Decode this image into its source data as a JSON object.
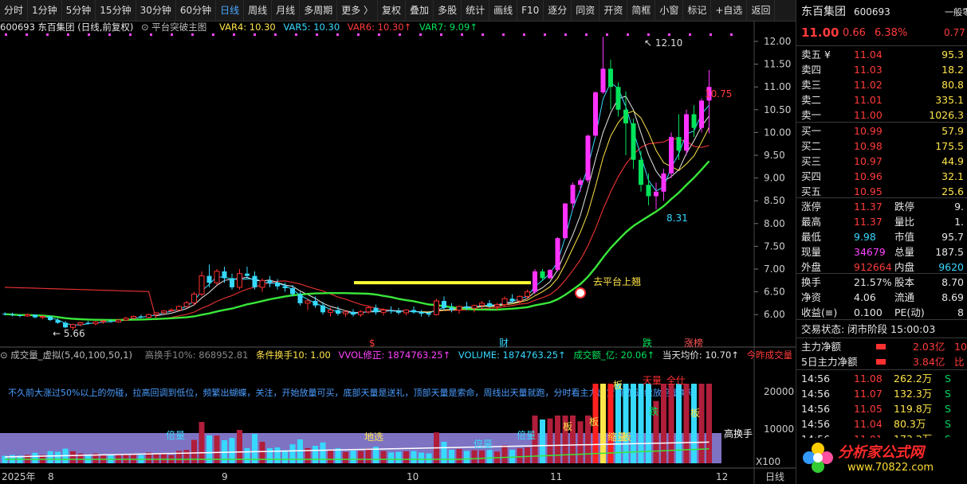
{
  "toolbar": {
    "items": [
      "分时",
      "1分钟",
      "5分钟",
      "15分钟",
      "30分钟",
      "60分钟",
      "日线",
      "周线",
      "月线",
      "多周期",
      "更多 〉",
      "复权",
      "叠加",
      "多股",
      "统计",
      "画线",
      "F10",
      "逐分",
      "同资",
      "开资",
      "简框",
      "小窗",
      "标记",
      "+自选",
      "返回"
    ],
    "active": "日线"
  },
  "infobar": {
    "stock": "600693 东百集团 (日线,前复权)",
    "indicator": "平台突破主图",
    "var4": "VAR4: 10.30",
    "var5": "VAR5: 10.30",
    "var6": "VAR6: 10.30↑",
    "var7": "VAR7: 9.09↑"
  },
  "price_axis": [
    "12.00",
    "11.50",
    "11.00",
    "10.50",
    "10.00",
    "9.50",
    "9.00",
    "8.50",
    "8.00",
    "7.50",
    "7.00",
    "6.50",
    "6.00"
  ],
  "chart_annotations": {
    "high_label": "12.10",
    "low_label": "5.66",
    "dip_label": "8.31",
    "last_label": "10.75",
    "breakout_text": "去平台上翘",
    "markers": [
      "$",
      "财",
      "跌",
      "涨榜"
    ]
  },
  "volinfo": {
    "title": "成交量_虚拟(5,40,100,50,1)",
    "hsl": "高换手10%: 868952.81",
    "cond": "条件换手10: 1.00",
    "vvol": "VVOL修正: 1874763.25↑",
    "volume": "VOLUME: 1874763.25↑",
    "amount": "成交额_亿: 20.06↑",
    "avg": "当天均价: 10.70↑",
    "today": "今昨成交量"
  },
  "vol_axis": [
    "20000",
    "10000",
    "X100"
  ],
  "vol_note": "不久前大涨过50%以上的勿碰，拉高回调到低位，频繁出蝴蝶，关注，开始放量可买，底部天量是送礼，顶部天量是索命，周线出天量就跑，分时看主力出货痕迹,连续放倍量4天",
  "vol_labels": [
    "倍量",
    "地选",
    "倍量",
    "倍量",
    "板",
    "板",
    "天量",
    "全仕",
    "板",
    "板",
    "缩量",
    "跌",
    "板",
    "高换手"
  ],
  "time_axis": [
    "2025年",
    "8",
    "9",
    "10",
    "11",
    "12"
  ],
  "time_axis_right": "日线",
  "panel": {
    "name": "东百集团",
    "code": "600693",
    "sector": "一般零",
    "price": "11.00",
    "change": "0.66",
    "pct": "6.38%",
    "extra": "0.77",
    "sells": [
      {
        "label": "卖五 ¥",
        "price": "11.04",
        "vol": "95.3"
      },
      {
        "label": "卖四",
        "price": "11.03",
        "vol": "18.2"
      },
      {
        "label": "卖三",
        "price": "11.02",
        "vol": "80.8"
      },
      {
        "label": "卖二",
        "price": "11.01",
        "vol": "335.1"
      },
      {
        "label": "卖一",
        "price": "11.00",
        "vol": "1026.3"
      }
    ],
    "buys": [
      {
        "label": "买一",
        "price": "10.99",
        "vol": "57.9"
      },
      {
        "label": "买二",
        "price": "10.98",
        "vol": "175.5"
      },
      {
        "label": "买三",
        "price": "10.97",
        "vol": "44.9"
      },
      {
        "label": "买四",
        "price": "10.96",
        "vol": "32.1"
      },
      {
        "label": "买五",
        "price": "10.95",
        "vol": "25.6"
      }
    ],
    "stats": [
      {
        "l1": "涨停",
        "v1": "11.37",
        "l2": "跌停",
        "v2": "9."
      },
      {
        "l1": "最高",
        "v1": "11.37",
        "l2": "量比",
        "v2": "1."
      },
      {
        "l1": "最低",
        "v1": "9.98",
        "l2": "市值",
        "v2": "95.7"
      },
      {
        "l1": "现量",
        "v1": "34679",
        "l2": "总量",
        "v2": "187.5"
      },
      {
        "l1": "外盘",
        "v1": "912664",
        "l2": "内盘",
        "v2": "9620"
      }
    ],
    "stats2": [
      {
        "l1": "换手",
        "v1": "21.57%",
        "l2": "股本",
        "v2": "8.70"
      },
      {
        "l1": "净资",
        "v1": "4.06",
        "l2": "流通",
        "v2": "8.69"
      },
      {
        "l1": "收益(≡)",
        "v1": "0.100",
        "l2": "PE(动)",
        "v2": "8"
      }
    ],
    "status": "交易状态: 闭市阶段 15:00:03",
    "flow": [
      {
        "label": "主力净额",
        "value": "2.03亿",
        "extra": "10"
      },
      {
        "label": "5日主力净额",
        "value": "3.84亿",
        "extra": "比"
      }
    ],
    "ticks": [
      {
        "time": "14:56",
        "price": "11.08",
        "vol": "262.2万",
        "side": "S"
      },
      {
        "time": "14:56",
        "price": "11.07",
        "vol": "132.3万",
        "side": "S"
      },
      {
        "time": "14:56",
        "price": "11.05",
        "vol": "119.8万",
        "side": "S"
      },
      {
        "time": "14:56",
        "price": "11.04",
        "vol": "80.3万",
        "side": "S"
      },
      {
        "time": "14:56",
        "price": "11.01",
        "vol": "173.2万",
        "side": "S"
      }
    ],
    "watermark": "分析家公式网",
    "watermark_url": "www.70822.com"
  },
  "candles": [
    [
      6.02,
      6.05,
      5.98,
      6.01
    ],
    [
      6.01,
      6.04,
      5.96,
      5.99
    ],
    [
      5.99,
      6.0,
      5.94,
      5.97
    ],
    [
      5.97,
      6.02,
      5.95,
      6.0
    ],
    [
      6.0,
      6.01,
      5.92,
      5.94
    ],
    [
      5.94,
      5.98,
      5.9,
      5.96
    ],
    [
      5.96,
      5.97,
      5.86,
      5.88
    ],
    [
      5.88,
      5.92,
      5.8,
      5.82
    ],
    [
      5.82,
      5.86,
      5.7,
      5.72
    ],
    [
      5.72,
      5.8,
      5.66,
      5.78
    ],
    [
      5.78,
      5.84,
      5.74,
      5.82
    ],
    [
      5.82,
      5.86,
      5.78,
      5.8
    ],
    [
      5.8,
      5.86,
      5.76,
      5.84
    ],
    [
      5.84,
      5.88,
      5.8,
      5.86
    ],
    [
      5.86,
      5.9,
      5.82,
      5.84
    ],
    [
      5.84,
      5.9,
      5.82,
      5.88
    ],
    [
      5.88,
      5.95,
      5.86,
      5.92
    ],
    [
      5.92,
      5.98,
      5.9,
      5.96
    ],
    [
      5.96,
      6.0,
      5.92,
      5.94
    ],
    [
      5.94,
      6.02,
      5.92,
      6.0
    ],
    [
      6.0,
      6.05,
      5.96,
      6.04
    ],
    [
      6.04,
      6.1,
      6.02,
      6.08
    ],
    [
      6.08,
      6.14,
      6.06,
      6.1
    ],
    [
      6.1,
      6.2,
      6.08,
      6.18
    ],
    [
      6.18,
      6.3,
      6.15,
      6.26
    ],
    [
      6.26,
      6.5,
      6.2,
      6.45
    ],
    [
      6.45,
      6.95,
      6.4,
      6.85
    ],
    [
      6.85,
      7.1,
      6.6,
      6.7
    ],
    [
      6.7,
      7.0,
      6.65,
      6.95
    ],
    [
      6.95,
      7.05,
      6.7,
      6.8
    ],
    [
      6.8,
      6.9,
      6.55,
      6.6
    ],
    [
      6.6,
      7.0,
      6.55,
      6.9
    ],
    [
      6.9,
      7.05,
      6.8,
      6.85
    ],
    [
      6.85,
      6.95,
      6.55,
      6.6
    ],
    [
      6.6,
      6.8,
      6.5,
      6.75
    ],
    [
      6.75,
      6.85,
      6.6,
      6.7
    ],
    [
      6.7,
      6.78,
      6.55,
      6.62
    ],
    [
      6.62,
      6.7,
      6.5,
      6.58
    ],
    [
      6.58,
      6.65,
      6.4,
      6.45
    ],
    [
      6.45,
      6.5,
      6.2,
      6.25
    ],
    [
      6.25,
      6.35,
      6.1,
      6.3
    ],
    [
      6.3,
      6.4,
      6.15,
      6.2
    ],
    [
      6.2,
      6.28,
      6.0,
      6.05
    ],
    [
      6.05,
      6.15,
      5.96,
      6.1
    ],
    [
      6.1,
      6.18,
      5.98,
      6.02
    ],
    [
      6.02,
      6.1,
      5.95,
      6.06
    ],
    [
      6.06,
      6.12,
      5.96,
      6.0
    ],
    [
      6.0,
      6.1,
      5.95,
      6.06
    ],
    [
      6.06,
      6.2,
      6.02,
      6.15
    ],
    [
      6.15,
      6.22,
      6.0,
      6.05
    ],
    [
      6.05,
      6.14,
      5.98,
      6.1
    ],
    [
      6.1,
      6.18,
      6.02,
      6.08
    ],
    [
      6.08,
      6.15,
      6.0,
      6.04
    ],
    [
      6.04,
      6.12,
      5.98,
      6.1
    ],
    [
      6.1,
      6.18,
      6.02,
      6.05
    ],
    [
      6.05,
      6.1,
      5.96,
      6.02
    ],
    [
      6.02,
      6.08,
      5.95,
      6.0
    ],
    [
      6.0,
      6.35,
      5.98,
      6.3
    ],
    [
      6.3,
      6.4,
      6.1,
      6.15
    ],
    [
      6.15,
      6.25,
      6.05,
      6.1
    ],
    [
      6.1,
      6.2,
      6.02,
      6.18
    ],
    [
      6.18,
      6.28,
      6.1,
      6.14
    ],
    [
      6.14,
      6.22,
      6.05,
      6.2
    ],
    [
      6.2,
      6.3,
      6.12,
      6.25
    ],
    [
      6.25,
      6.32,
      6.15,
      6.18
    ],
    [
      6.18,
      6.26,
      6.1,
      6.22
    ],
    [
      6.22,
      6.4,
      6.18,
      6.35
    ],
    [
      6.35,
      6.45,
      6.25,
      6.3
    ],
    [
      6.3,
      6.42,
      6.25,
      6.4
    ],
    [
      6.4,
      6.55,
      6.35,
      6.5
    ],
    [
      6.5,
      7.0,
      6.45,
      6.95
    ],
    [
      6.95,
      7.0,
      6.75,
      6.8
    ],
    [
      6.8,
      7.0,
      6.78,
      6.98
    ],
    [
      6.98,
      7.7,
      6.95,
      7.68
    ],
    [
      7.68,
      8.45,
      7.66,
      8.44
    ],
    [
      8.44,
      8.9,
      8.3,
      8.85
    ],
    [
      8.85,
      9.0,
      8.7,
      8.95
    ],
    [
      8.95,
      9.95,
      8.9,
      9.93
    ],
    [
      9.93,
      10.9,
      9.9,
      10.88
    ],
    [
      10.88,
      12.1,
      10.85,
      11.4
    ],
    [
      11.4,
      11.6,
      10.5,
      11.0
    ],
    [
      11.0,
      11.1,
      10.35,
      10.5
    ],
    [
      10.5,
      10.9,
      9.5,
      10.2
    ],
    [
      10.2,
      10.3,
      9.2,
      9.4
    ],
    [
      9.4,
      9.6,
      8.7,
      8.85
    ],
    [
      8.85,
      9.1,
      8.4,
      8.6
    ],
    [
      8.6,
      8.9,
      8.31,
      8.7
    ],
    [
      8.7,
      9.2,
      8.5,
      9.1
    ],
    [
      9.1,
      10.0,
      9.0,
      9.9
    ],
    [
      9.9,
      10.4,
      9.4,
      9.6
    ],
    [
      9.6,
      10.5,
      9.5,
      10.4
    ],
    [
      10.4,
      10.6,
      9.9,
      10.1
    ],
    [
      10.1,
      10.75,
      10.0,
      10.7
    ],
    [
      10.7,
      11.37,
      9.98,
      11.0
    ]
  ]
}
